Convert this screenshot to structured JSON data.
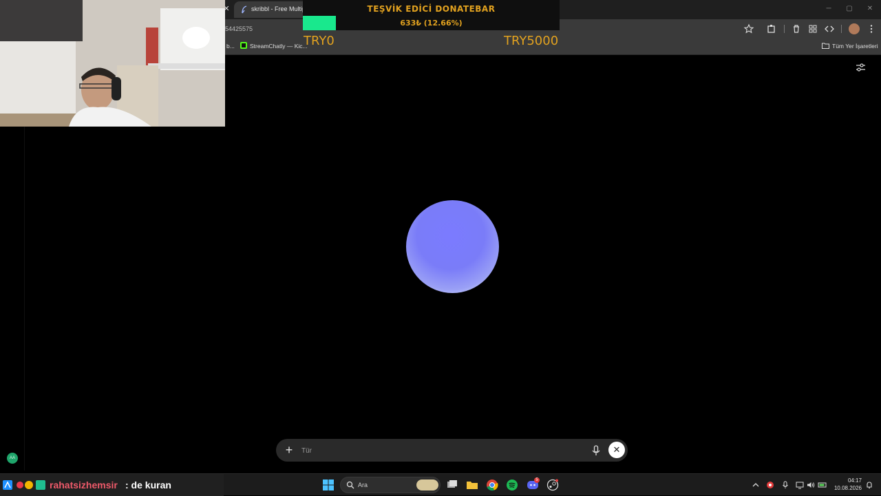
{
  "browser": {
    "tab_title": "skribbl - Free Multiplayer Drawi",
    "url_fragment": "54425575",
    "bookmarks": [
      "b...",
      "StreamChatly — Kic...",
      "Tüm Yer İşaretleri"
    ]
  },
  "donation": {
    "title": "TEŞVİK EDİCİ DONATEBAR",
    "amount": "633₺ (12.66%)",
    "progress_percent": 12.66,
    "min_label": "TRY0",
    "max_label": "TRY5000",
    "colors": {
      "text": "#e2a21f",
      "bar": "#19e88d"
    }
  },
  "page": {
    "orb_color": "#7b7bff"
  },
  "chat": {
    "placeholder": "Tür"
  },
  "badge": {
    "text": "AA"
  },
  "taskbar": {
    "ticker_user": "rahatsizhemsir",
    "ticker_message": ": de kuran",
    "search_label": "Ara",
    "apps": [
      "task-view",
      "file-explorer",
      "chrome",
      "spotify",
      "discord",
      "steam"
    ],
    "discord_badge": "5",
    "clock_time": "04:17",
    "clock_date": "10.08.2026"
  }
}
